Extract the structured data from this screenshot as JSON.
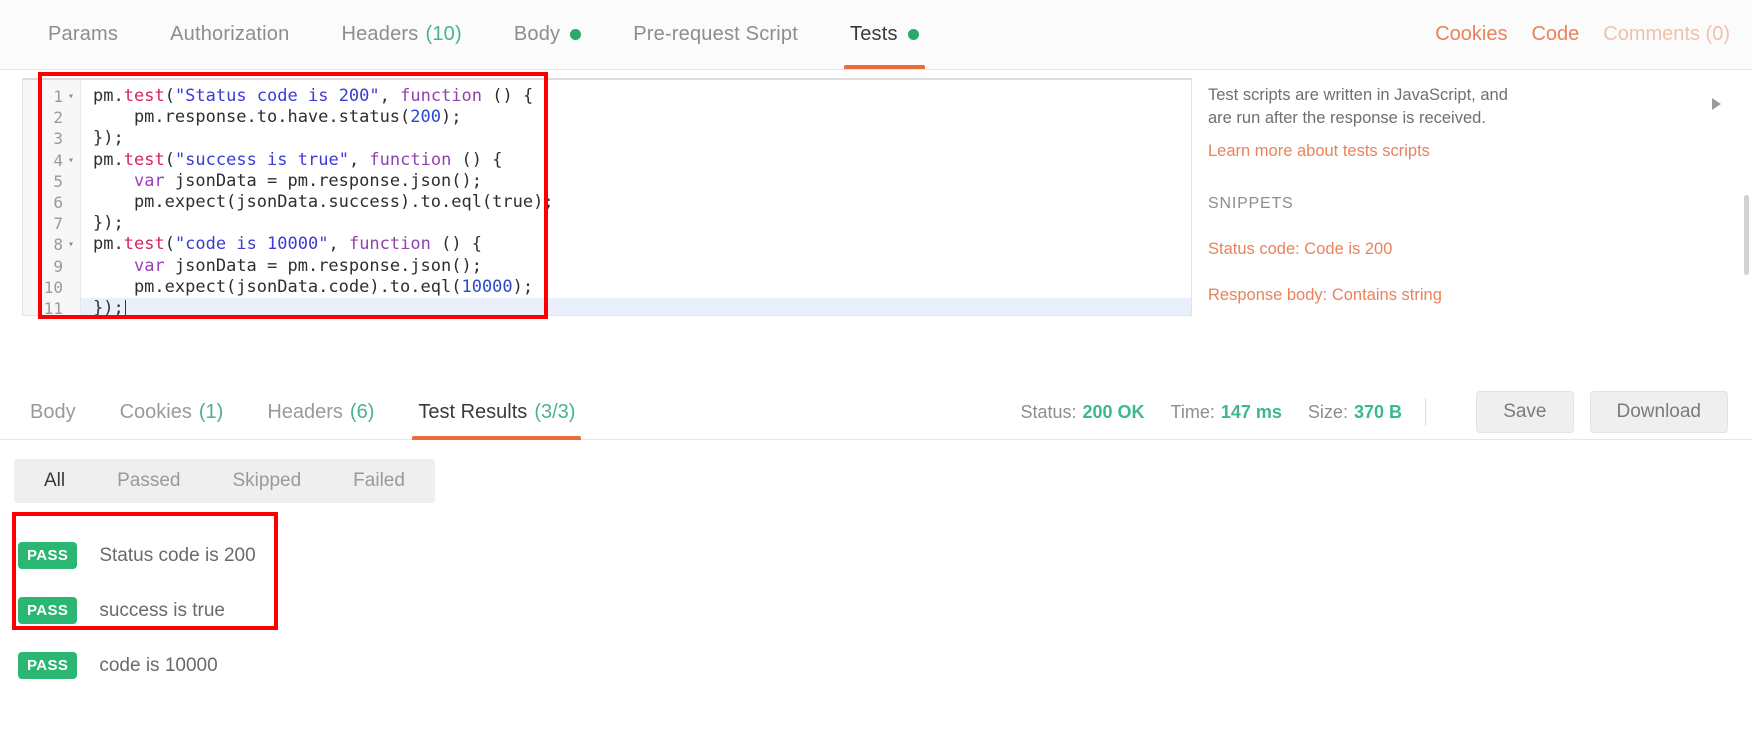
{
  "request_tabs": [
    {
      "label": "Params",
      "count": null,
      "dot": false,
      "active": false
    },
    {
      "label": "Authorization",
      "count": null,
      "dot": false,
      "active": false
    },
    {
      "label": "Headers",
      "count": "(10)",
      "dot": false,
      "active": false
    },
    {
      "label": "Body",
      "count": null,
      "dot": true,
      "active": false
    },
    {
      "label": "Pre-request Script",
      "count": null,
      "dot": false,
      "active": false
    },
    {
      "label": "Tests",
      "count": null,
      "dot": true,
      "active": true
    }
  ],
  "request_actions": [
    {
      "label": "Cookies",
      "muted": false
    },
    {
      "label": "Code",
      "muted": false
    },
    {
      "label": "Comments (0)",
      "muted": true
    }
  ],
  "editor": {
    "lines": [
      {
        "num": "1",
        "fold": true,
        "highlight": false,
        "tokens": [
          {
            "t": "pm",
            "c": ""
          },
          {
            "t": ".",
            "c": ""
          },
          {
            "t": "test",
            "c": "t-meth"
          },
          {
            "t": "(",
            "c": ""
          },
          {
            "t": "\"Status code is 200\"",
            "c": "t-str"
          },
          {
            "t": ", ",
            "c": ""
          },
          {
            "t": "function",
            "c": "t-fn"
          },
          {
            "t": " () {",
            "c": ""
          }
        ]
      },
      {
        "num": "2",
        "fold": false,
        "highlight": false,
        "tokens": [
          {
            "t": "    pm.response.to.have.status(",
            "c": ""
          },
          {
            "t": "200",
            "c": "t-num"
          },
          {
            "t": ");",
            "c": ""
          }
        ]
      },
      {
        "num": "3",
        "fold": false,
        "highlight": false,
        "tokens": [
          {
            "t": "});",
            "c": ""
          }
        ]
      },
      {
        "num": "4",
        "fold": true,
        "highlight": false,
        "tokens": [
          {
            "t": "pm",
            "c": ""
          },
          {
            "t": ".",
            "c": ""
          },
          {
            "t": "test",
            "c": "t-meth"
          },
          {
            "t": "(",
            "c": ""
          },
          {
            "t": "\"success is true\"",
            "c": "t-str"
          },
          {
            "t": ", ",
            "c": ""
          },
          {
            "t": "function",
            "c": "t-fn"
          },
          {
            "t": " () {",
            "c": ""
          }
        ]
      },
      {
        "num": "5",
        "fold": false,
        "highlight": false,
        "tokens": [
          {
            "t": "    ",
            "c": ""
          },
          {
            "t": "var",
            "c": "t-kw"
          },
          {
            "t": " jsonData = pm.response.json();",
            "c": ""
          }
        ]
      },
      {
        "num": "6",
        "fold": false,
        "highlight": false,
        "tokens": [
          {
            "t": "    pm.expect(jsonData.success).to.eql(true);",
            "c": ""
          }
        ]
      },
      {
        "num": "7",
        "fold": false,
        "highlight": false,
        "tokens": [
          {
            "t": "});",
            "c": ""
          }
        ]
      },
      {
        "num": "8",
        "fold": true,
        "highlight": false,
        "tokens": [
          {
            "t": "pm",
            "c": ""
          },
          {
            "t": ".",
            "c": ""
          },
          {
            "t": "test",
            "c": "t-meth"
          },
          {
            "t": "(",
            "c": ""
          },
          {
            "t": "\"code is 10000\"",
            "c": "t-str"
          },
          {
            "t": ", ",
            "c": ""
          },
          {
            "t": "function",
            "c": "t-fn"
          },
          {
            "t": " () {",
            "c": ""
          }
        ]
      },
      {
        "num": "9",
        "fold": false,
        "highlight": false,
        "tokens": [
          {
            "t": "    ",
            "c": ""
          },
          {
            "t": "var",
            "c": "t-kw"
          },
          {
            "t": " jsonData = pm.response.json();",
            "c": ""
          }
        ]
      },
      {
        "num": "10",
        "fold": false,
        "highlight": false,
        "tokens": [
          {
            "t": "    pm.expect(jsonData.code).to.eql(",
            "c": ""
          },
          {
            "t": "10000",
            "c": "t-num"
          },
          {
            "t": ");",
            "c": ""
          }
        ]
      },
      {
        "num": "11",
        "fold": false,
        "highlight": true,
        "tokens": [
          {
            "t": "});",
            "c": ""
          }
        ],
        "caret": true
      }
    ]
  },
  "docs": {
    "description": "Test scripts are written in JavaScript, and are run after the response is received.",
    "learn_more": "Learn more about tests scripts",
    "snippets_heading": "SNIPPETS",
    "snippets": [
      "Status code: Code is 200",
      "Response body: Contains string"
    ]
  },
  "response_tabs": [
    {
      "label": "Body",
      "count": null,
      "active": false
    },
    {
      "label": "Cookies",
      "count": "(1)",
      "active": false
    },
    {
      "label": "Headers",
      "count": "(6)",
      "active": false
    },
    {
      "label": "Test Results",
      "count": "(3/3)",
      "active": true
    }
  ],
  "response_meta": [
    {
      "label": "Status:",
      "value": "200 OK"
    },
    {
      "label": "Time:",
      "value": "147 ms"
    },
    {
      "label": "Size:",
      "value": "370 B"
    }
  ],
  "response_buttons": [
    {
      "label": "Save"
    },
    {
      "label": "Download"
    }
  ],
  "result_filters": [
    {
      "label": "All",
      "active": true
    },
    {
      "label": "Passed",
      "active": false
    },
    {
      "label": "Skipped",
      "active": false
    },
    {
      "label": "Failed",
      "active": false
    }
  ],
  "test_results": [
    {
      "status": "PASS",
      "name": "Status code is 200"
    },
    {
      "status": "PASS",
      "name": "success is true"
    },
    {
      "status": "PASS",
      "name": "code is 10000"
    }
  ],
  "colors": {
    "accent_orange": "#eb6c3a",
    "link_orange": "#e8835b",
    "pass_green": "#2bb673",
    "meta_green": "#3bb98a",
    "annotation_red": "#fb0000"
  }
}
